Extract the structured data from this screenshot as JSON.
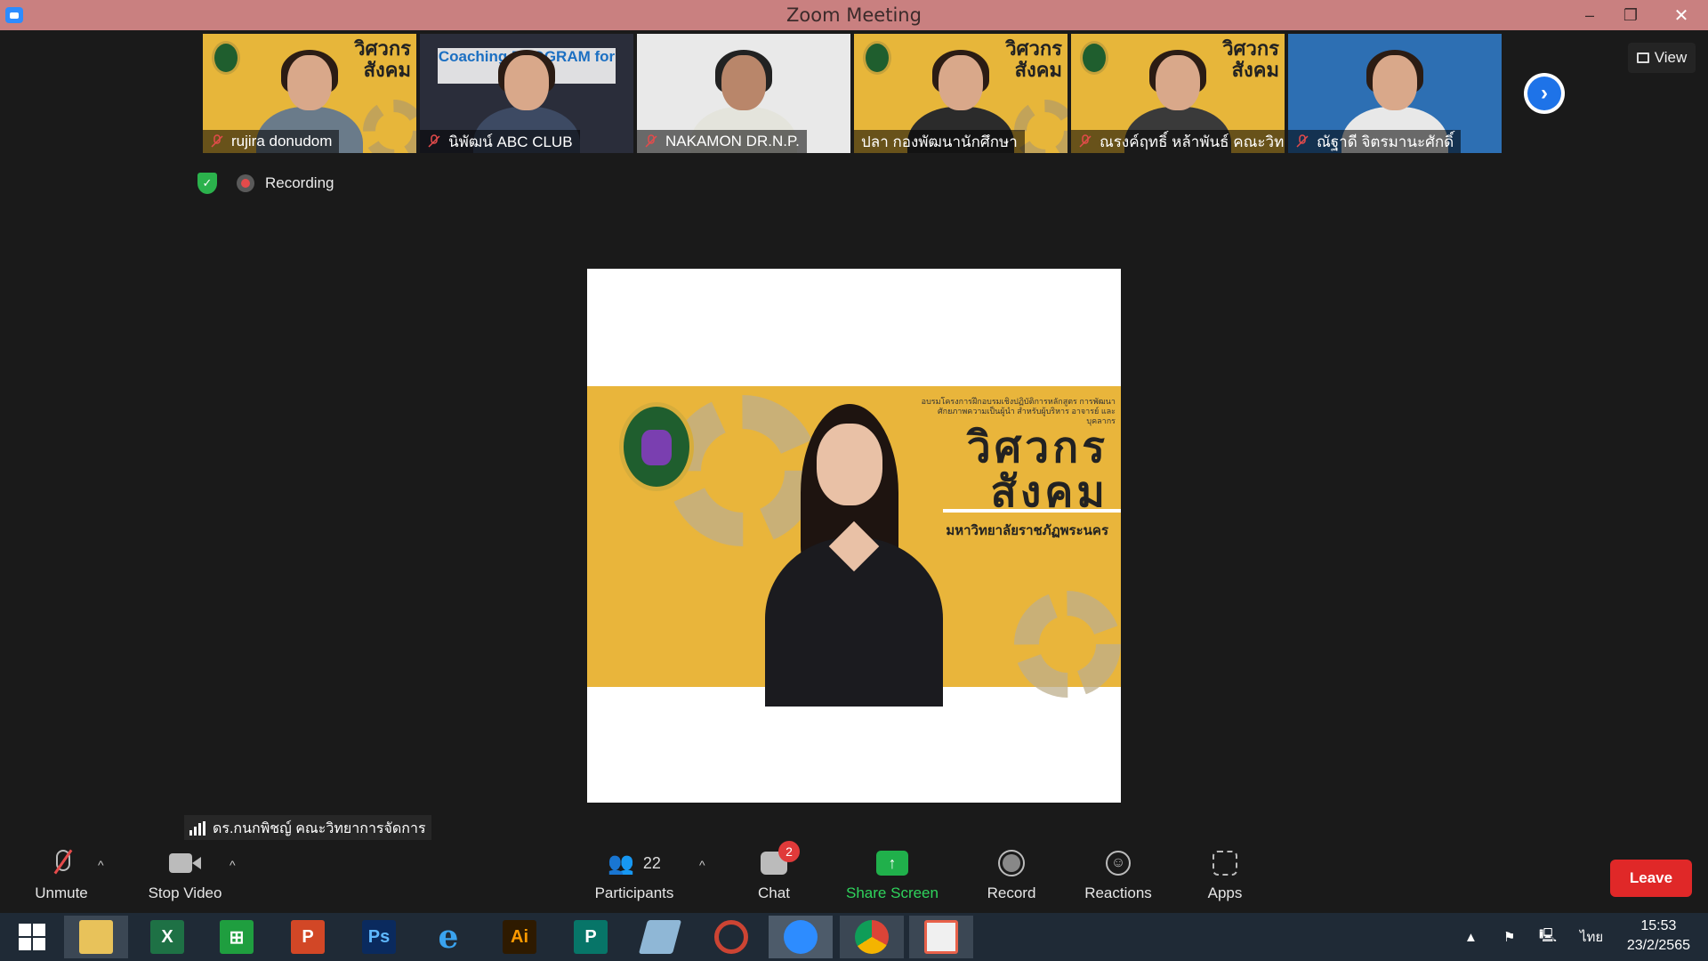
{
  "window": {
    "title": "Zoom Meeting",
    "minimize": "–",
    "maximize": "❐",
    "close": "✕"
  },
  "gallery": {
    "participants": [
      {
        "name": "rujira donudom",
        "muted": true
      },
      {
        "name": "นิพัฒน์ ABC CLUB",
        "muted": true,
        "overlay_text": "Coaching PROGRAM for Career"
      },
      {
        "name": "NAKAMON DR.N.P.",
        "muted": true
      },
      {
        "name": "ปลา กองพัฒนานักศึกษา",
        "muted": false
      },
      {
        "name": "ณรงค์ฤทธิ์ หล้าพันธ์ คณะวิทย์",
        "muted": true
      },
      {
        "name": "ณัฐาดี จิตรมานะศักดิ์",
        "muted": true
      }
    ],
    "next_icon": "chevron-right-icon",
    "view_label": "View"
  },
  "status": {
    "recording_label": "Recording",
    "encryption_icon": "shield-check-icon"
  },
  "main_video": {
    "banner_title_line1": "วิศวกร",
    "banner_title_line2": "สังคม",
    "banner_university": "มหาวิทยาลัยราชภัฏพระนคร",
    "banner_small_text": "อบรมโครงการฝึกอบรมเชิงปฏิบัติการหลักสูตร การพัฒนาศักยภาพความเป็นผู้นำ สำหรับผู้บริหาร อาจารย์ และบุคลากร"
  },
  "active_speaker": {
    "name": "ดร.กนกพิชญ์ คณะวิทยาการจัดการ"
  },
  "toolbar": {
    "unmute": "Unmute",
    "stop_video": "Stop Video",
    "participants": "Participants",
    "participants_count": "22",
    "chat": "Chat",
    "chat_badge": "2",
    "share_screen": "Share Screen",
    "record": "Record",
    "reactions": "Reactions",
    "apps": "Apps",
    "leave": "Leave",
    "caret": "^"
  },
  "taskbar": {
    "apps": [
      {
        "name": "file-explorer",
        "label": ""
      },
      {
        "name": "excel",
        "label": "X"
      },
      {
        "name": "store",
        "label": "⊞"
      },
      {
        "name": "powerpoint",
        "label": "P"
      },
      {
        "name": "photoshop",
        "label": "Ps"
      },
      {
        "name": "internet-explorer",
        "label": "e"
      },
      {
        "name": "illustrator",
        "label": "Ai"
      },
      {
        "name": "publisher",
        "label": "P"
      },
      {
        "name": "notepad",
        "label": ""
      },
      {
        "name": "photoscape",
        "label": ""
      },
      {
        "name": "zoom",
        "label": ""
      },
      {
        "name": "chrome",
        "label": ""
      },
      {
        "name": "office",
        "label": ""
      }
    ],
    "language": "ไทย",
    "time": "15:53",
    "date": "23/2/2565"
  },
  "colors": {
    "titlebar": "#c98080",
    "accent_blue": "#1e73e8",
    "share_green": "#20b04b",
    "leave_red": "#e02828"
  }
}
